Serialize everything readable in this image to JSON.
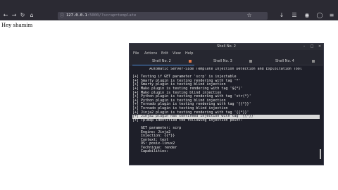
{
  "browser": {
    "url_host": "127.0.0.1",
    "url_rest": ":5000/?scrap=template",
    "page_text": "Hey shamim"
  },
  "terminal": {
    "title": "Shell No. 2",
    "menu": [
      "File",
      "Actions",
      "Edit",
      "View",
      "Help"
    ],
    "tabs": [
      {
        "label": "Shell No. 2",
        "active": true
      },
      {
        "label": "Shell No. 3",
        "active": false
      },
      {
        "label": "Shell No. 4",
        "active": false
      }
    ],
    "lines": [
      "        Automatic Server-Side Template Injection Detection and Exploitation Tool",
      "",
      "[+] Testing if GET parameter 'scrp' is injectable",
      "[+] Smarty plugin is testing rendering with tag '*'",
      "[+] Smarty plugin is testing blind injection",
      "[+] Mako plugin is testing rendering with tag '${*}'",
      "[+] Mako plugin is testing blind injection",
      "[+] Python plugin is testing rendering with tag 'str(*)'",
      "[+] Python plugin is testing blind injection",
      "[+] Tornado plugin is testing rendering with tag '{{*}}'",
      "[+] Tornado plugin is testing blind injection",
      "[+] Jinja2 plugin is testing rendering with tag '{{*}}'",
      "[+] Jinja2 plugin has confirmed injection with tag '{{*}}'",
      "[+] Tplmap identified the following injection point:",
      "",
      "    GET parameter: scrp",
      "    Engine: Jinja2",
      "    Injection: {{*}}",
      "    Context: text",
      "    OS: posix-linux2",
      "    Technique: render",
      "    Capabilities:"
    ],
    "highlight_line_index": 12
  }
}
